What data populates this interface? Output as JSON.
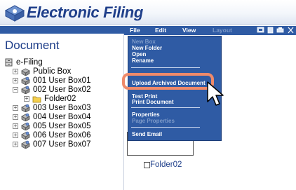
{
  "header": {
    "title": "Electronic Filing",
    "logo_icon": "electronic-filing-logo-icon"
  },
  "left_pane": {
    "title": "Document",
    "tree": [
      {
        "label": "e-Filing",
        "icon": "efiling-cabinet-icon"
      },
      {
        "label": "Public Box",
        "icon": "public-box-icon"
      },
      {
        "label": "001 User Box01",
        "icon": "user-box-icon"
      },
      {
        "label": "002 User Box02",
        "icon": "user-box-icon"
      },
      {
        "label": "Folder02",
        "icon": "folder-icon"
      },
      {
        "label": "003 User Box03",
        "icon": "user-box-icon"
      },
      {
        "label": "004 User Box04",
        "icon": "user-box-icon"
      },
      {
        "label": "005 User Box05",
        "icon": "user-box-icon"
      },
      {
        "label": "006 User Box06",
        "icon": "user-box-icon"
      },
      {
        "label": "007 User Box07",
        "icon": "user-box-icon"
      }
    ],
    "expand_symbol": "+",
    "collapse_symbol": "−"
  },
  "menubar": {
    "file": "File",
    "edit": "Edit",
    "view": "View",
    "layout": "Layout"
  },
  "file_menu": {
    "new_box": "New Box",
    "new_folder": "New Folder",
    "open": "Open",
    "rename": "Rename",
    "upload_archived": "Upload Archived Document",
    "test_print": "Test Print",
    "print_document": "Print Document",
    "properties": "Properties",
    "page_properties": "Page Properties",
    "send_email": "Send Email"
  },
  "content": {
    "folder_label": "Folder02"
  },
  "colors": {
    "accent": "#2f5ba4",
    "title": "#1f3f8a",
    "highlight": "#ef8a6a"
  }
}
